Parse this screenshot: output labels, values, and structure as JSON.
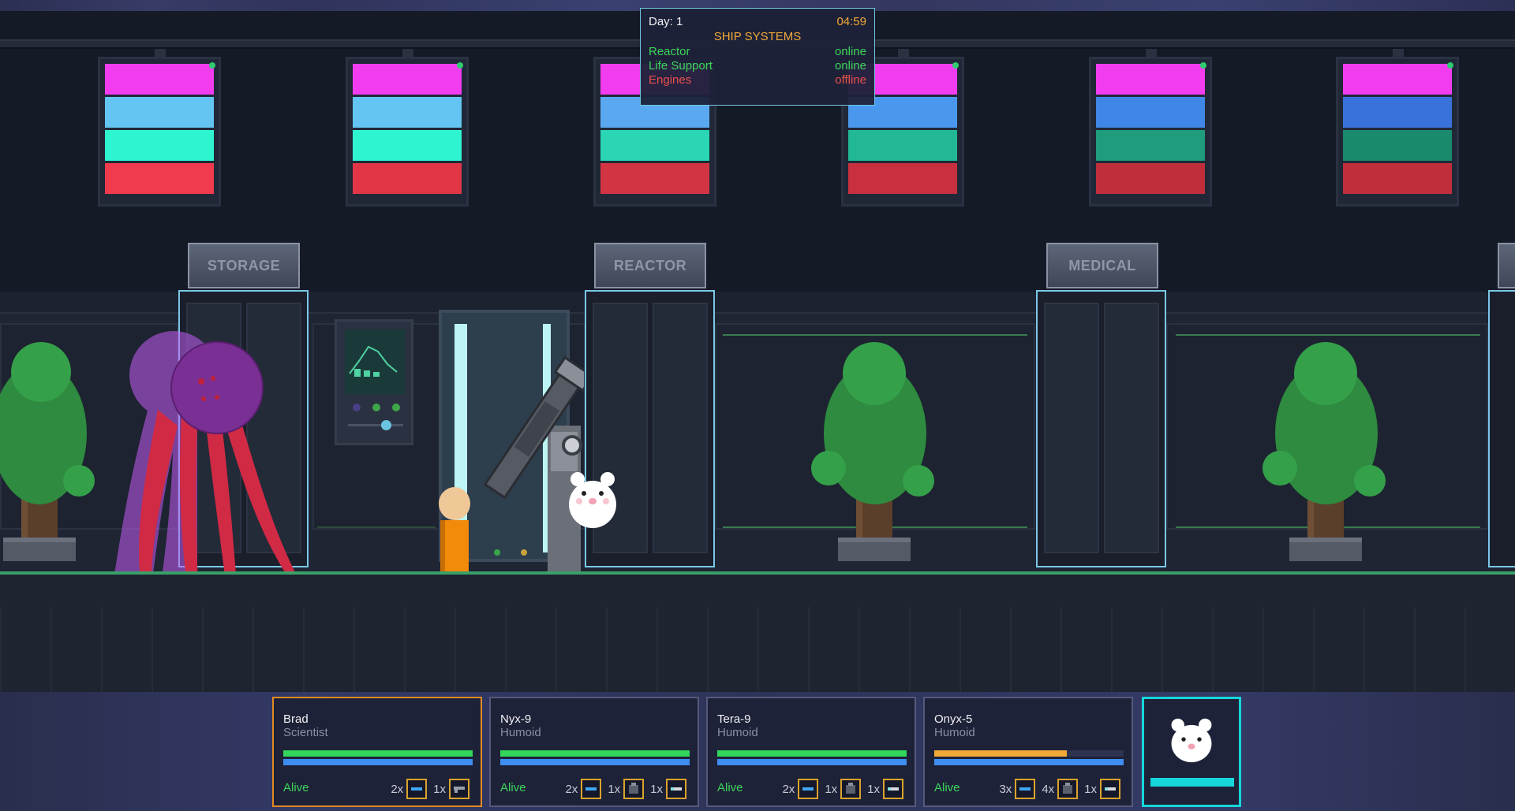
{
  "systems": {
    "day_label": "Day: 1",
    "time": "04:59",
    "title": "SHIP SYSTEMS",
    "rows": [
      {
        "name": "Reactor",
        "state": "online",
        "color": "#3cd65a"
      },
      {
        "name": "Life Support",
        "state": "online",
        "color": "#3cd65a"
      },
      {
        "name": "Engines",
        "state": "offline",
        "color": "#e8504a"
      }
    ]
  },
  "rooms": {
    "storage": "STORAGE",
    "reactor": "REACTOR",
    "medical": "MEDICAL"
  },
  "ceiling_panels": [
    [
      "#f23cf0",
      "#64c4f2",
      "#2ef5d0",
      "#f23a4e"
    ],
    [
      "#f23cf0",
      "#64c4f2",
      "#2ef5d0",
      "#e23646"
    ],
    [
      "#f23cf0",
      "#5aa8f0",
      "#2ad6b4",
      "#d23444"
    ],
    [
      "#f23cf0",
      "#4a98ee",
      "#22b896",
      "#c8303f"
    ],
    [
      "#f23cf0",
      "#3f86e6",
      "#1e9c7c",
      "#c02e3c"
    ],
    [
      "#f23cf0",
      "#3a72dc",
      "#1a8a6c",
      "#c02e3c"
    ]
  ],
  "crew": [
    {
      "name": "Brad",
      "role": "Scientist",
      "health": 1.0,
      "health_color": "#32d65a",
      "energy": 1.0,
      "status": "Alive",
      "selected": true,
      "items": [
        {
          "count": "2x",
          "icon": "battery-icon"
        },
        {
          "count": "1x",
          "icon": "gun-icon"
        }
      ]
    },
    {
      "name": "Nyx-9",
      "role": "Humoid",
      "health": 1.0,
      "health_color": "#32d65a",
      "energy": 1.0,
      "status": "Alive",
      "selected": false,
      "items": [
        {
          "count": "2x",
          "icon": "battery-icon"
        },
        {
          "count": "1x",
          "icon": "chip-icon"
        },
        {
          "count": "1x",
          "icon": "key-icon"
        }
      ]
    },
    {
      "name": "Tera-9",
      "role": "Humoid",
      "health": 1.0,
      "health_color": "#32d65a",
      "energy": 1.0,
      "status": "Alive",
      "selected": false,
      "items": [
        {
          "count": "2x",
          "icon": "battery-icon"
        },
        {
          "count": "1x",
          "icon": "chip-icon"
        },
        {
          "count": "1x",
          "icon": "key-icon"
        }
      ]
    },
    {
      "name": "Onyx-5",
      "role": "Humoid",
      "health": 0.7,
      "health_color": "#f2a93a",
      "energy": 1.0,
      "status": "Alive",
      "selected": false,
      "items": [
        {
          "count": "3x",
          "icon": "battery-icon"
        },
        {
          "count": "4x",
          "icon": "chip-icon"
        },
        {
          "count": "1x",
          "icon": "key-icon"
        }
      ]
    }
  ],
  "pet": {
    "icon": "bear-icon",
    "energy": 1.0,
    "accent": "#16d6d9"
  }
}
